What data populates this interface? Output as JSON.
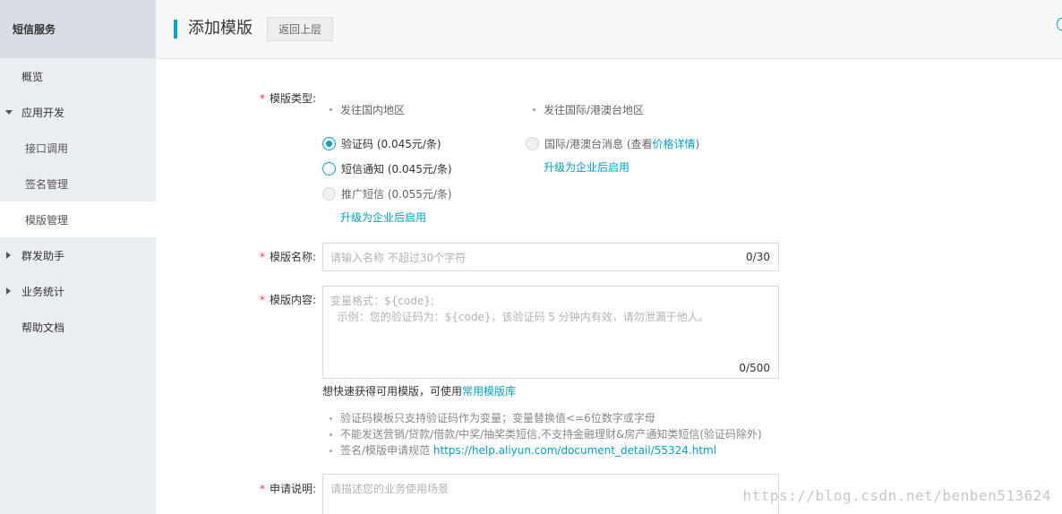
{
  "sidebar": {
    "title": "短信服务",
    "items": [
      {
        "label": "概览"
      },
      {
        "label": "应用开发"
      },
      {
        "label": "接口调用"
      },
      {
        "label": "签名管理"
      },
      {
        "label": "模版管理"
      },
      {
        "label": "群发助手"
      },
      {
        "label": "业务统计"
      },
      {
        "label": "帮助文档"
      }
    ]
  },
  "header": {
    "title": "添加模版",
    "back_label": "返回上层"
  },
  "form": {
    "type": {
      "label": "模版类型:",
      "domestic_heading": "发往国内地区",
      "intl_heading": "发往国际/港澳台地区",
      "options": [
        {
          "label": "验证码 (0.045元/条)",
          "state": "checked"
        },
        {
          "label": "短信通知 (0.045元/条)",
          "state": "unchecked"
        },
        {
          "label": "推广短信 (0.055元/条)",
          "state": "disabled"
        }
      ],
      "domestic_upgrade": "升级为企业后启用",
      "intl_option_prefix": "国际/港澳台消息 (查看",
      "intl_option_link": "价格详情",
      "intl_option_suffix": ")",
      "intl_upgrade": "升级为企业后启用"
    },
    "name": {
      "label": "模版名称:",
      "placeholder": "请输入名称 不超过30个字符",
      "counter": "0/30"
    },
    "content": {
      "label": "模版内容:",
      "placeholder_line1": "变量格式：${code};",
      "placeholder_line2": "  示例：您的验证码为：${code}，该验证码 5 分钟内有效，请勿泄漏于他人。",
      "counter": "0/500",
      "hint_prefix": "想快速获得可用模版，可使用",
      "hint_link": "常用模版库",
      "notes": [
        "验证码模板只支持验证码作为变量；变量替换值<=6位数字或字母",
        "不能发送营销/贷款/借款/中奖/抽奖类短信,不支持金融理财&房产通知类短信(验证码除外)"
      ],
      "spec_prefix": "签名/模版申请规范 ",
      "spec_link": "https://help.aliyun.com/document_detail/55324.html"
    },
    "description": {
      "label": "申请说明:",
      "placeholder": "请描述您的业务使用场景"
    }
  },
  "watermark": "https://blog.csdn.net/benben513624"
}
